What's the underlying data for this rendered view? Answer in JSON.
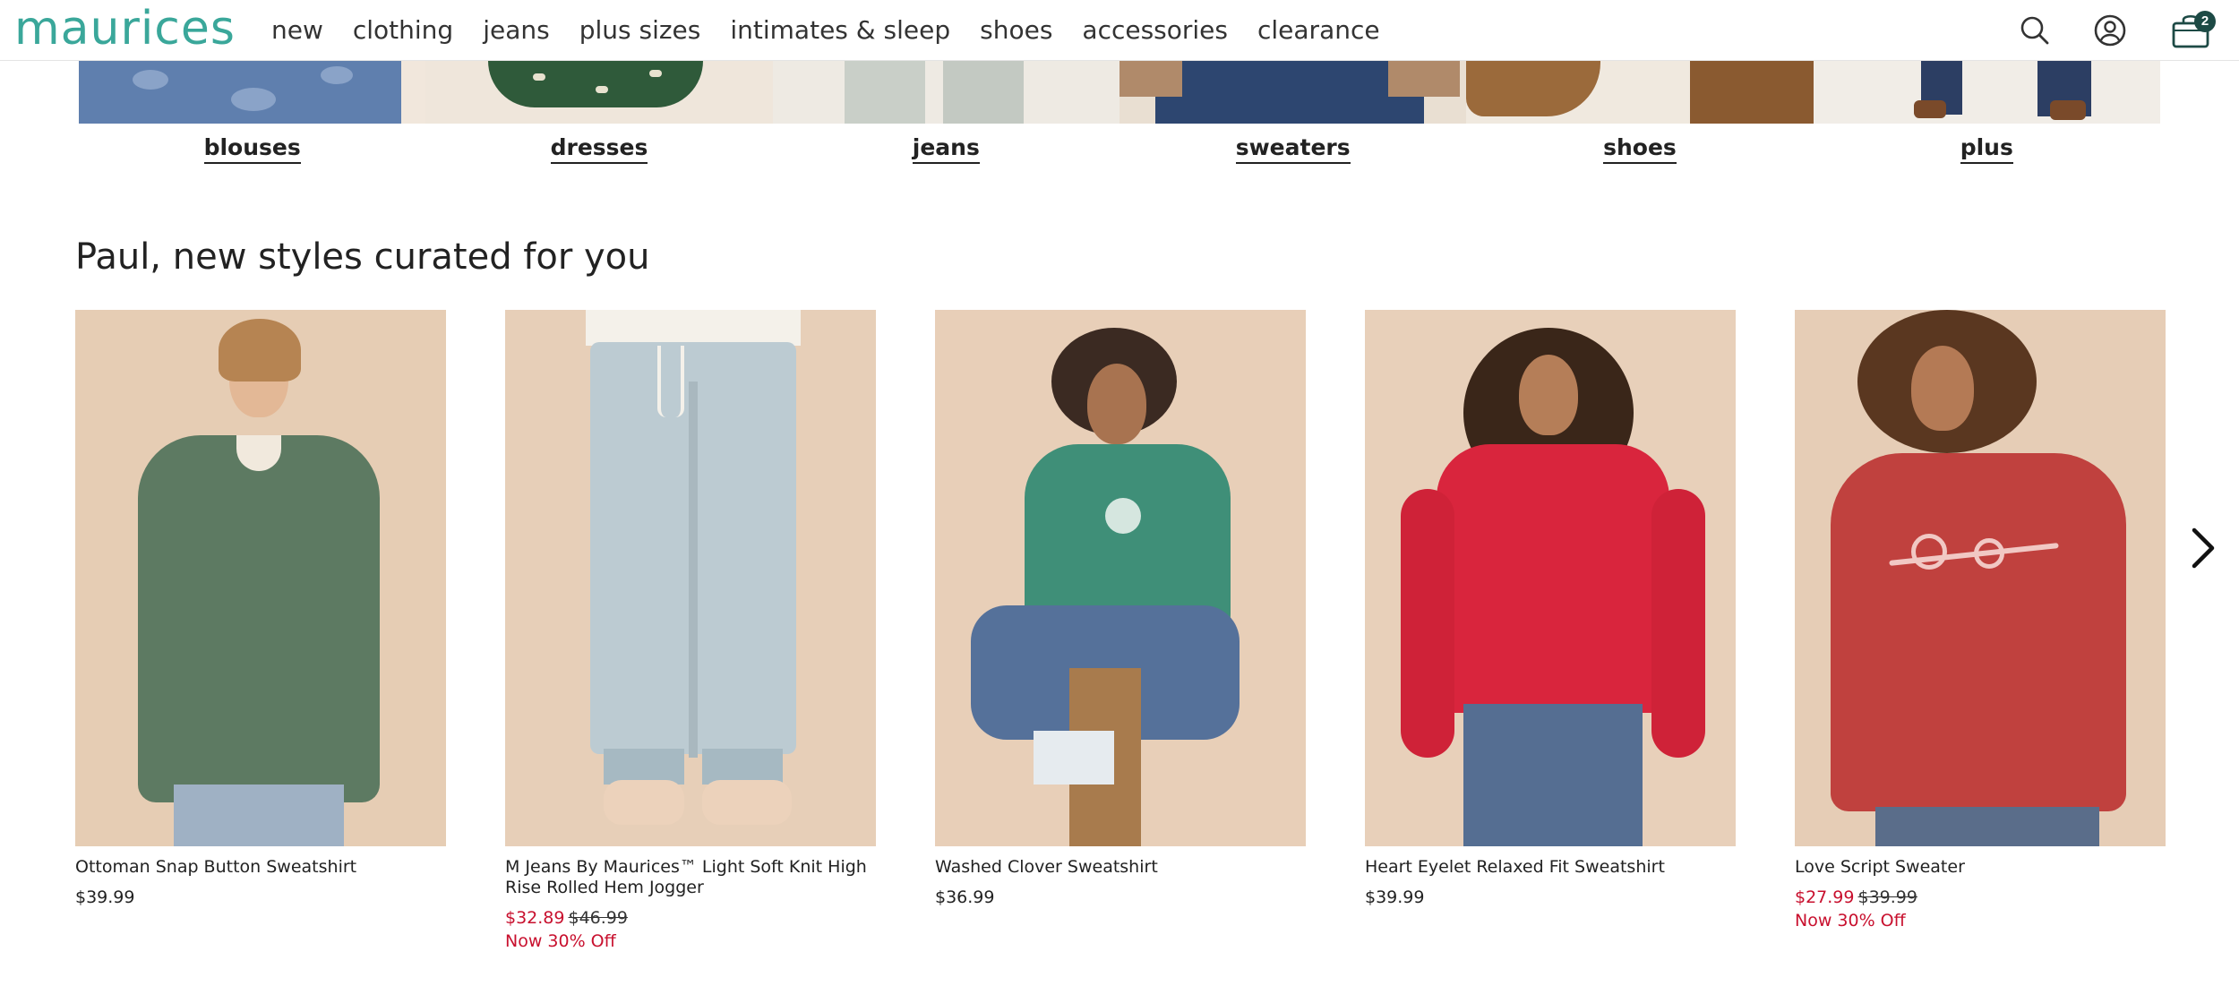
{
  "header": {
    "logo": "maurices",
    "nav": [
      "new",
      "clothing",
      "jeans",
      "plus sizes",
      "intimates & sleep",
      "shoes",
      "accessories",
      "clearance"
    ],
    "bag_count": "2",
    "icons": [
      "search-icon",
      "account-icon",
      "shopping-bag-icon"
    ]
  },
  "categories": [
    "blouses",
    "dresses",
    "jeans",
    "sweaters",
    "shoes",
    "plus"
  ],
  "curated": {
    "title": "Paul, new styles curated for you",
    "products": [
      {
        "name": "Ottoman Snap Button Sweatshirt",
        "price": "$39.99",
        "sale_price": "",
        "original_price": "",
        "promo": ""
      },
      {
        "name": "M Jeans By Maurices™ Light Soft Knit High Rise Rolled Hem Jogger",
        "price": "",
        "sale_price": "$32.89",
        "original_price": "$46.99",
        "promo": "Now 30% Off"
      },
      {
        "name": "Washed Clover Sweatshirt",
        "price": "$36.99",
        "sale_price": "",
        "original_price": "",
        "promo": ""
      },
      {
        "name": "Heart Eyelet Relaxed Fit Sweatshirt",
        "price": "$39.99",
        "sale_price": "",
        "original_price": "",
        "promo": ""
      },
      {
        "name": "Love Script Sweater",
        "price": "",
        "sale_price": "$27.99",
        "original_price": "$39.99",
        "promo": "Now 30% Off"
      }
    ],
    "next_icon": "chevron-right-icon"
  },
  "colors": {
    "brand": "#3aa79a",
    "sale": "#c8102e",
    "bag_badge": "#1d4a45",
    "image_bg": "#e9cfb7"
  }
}
